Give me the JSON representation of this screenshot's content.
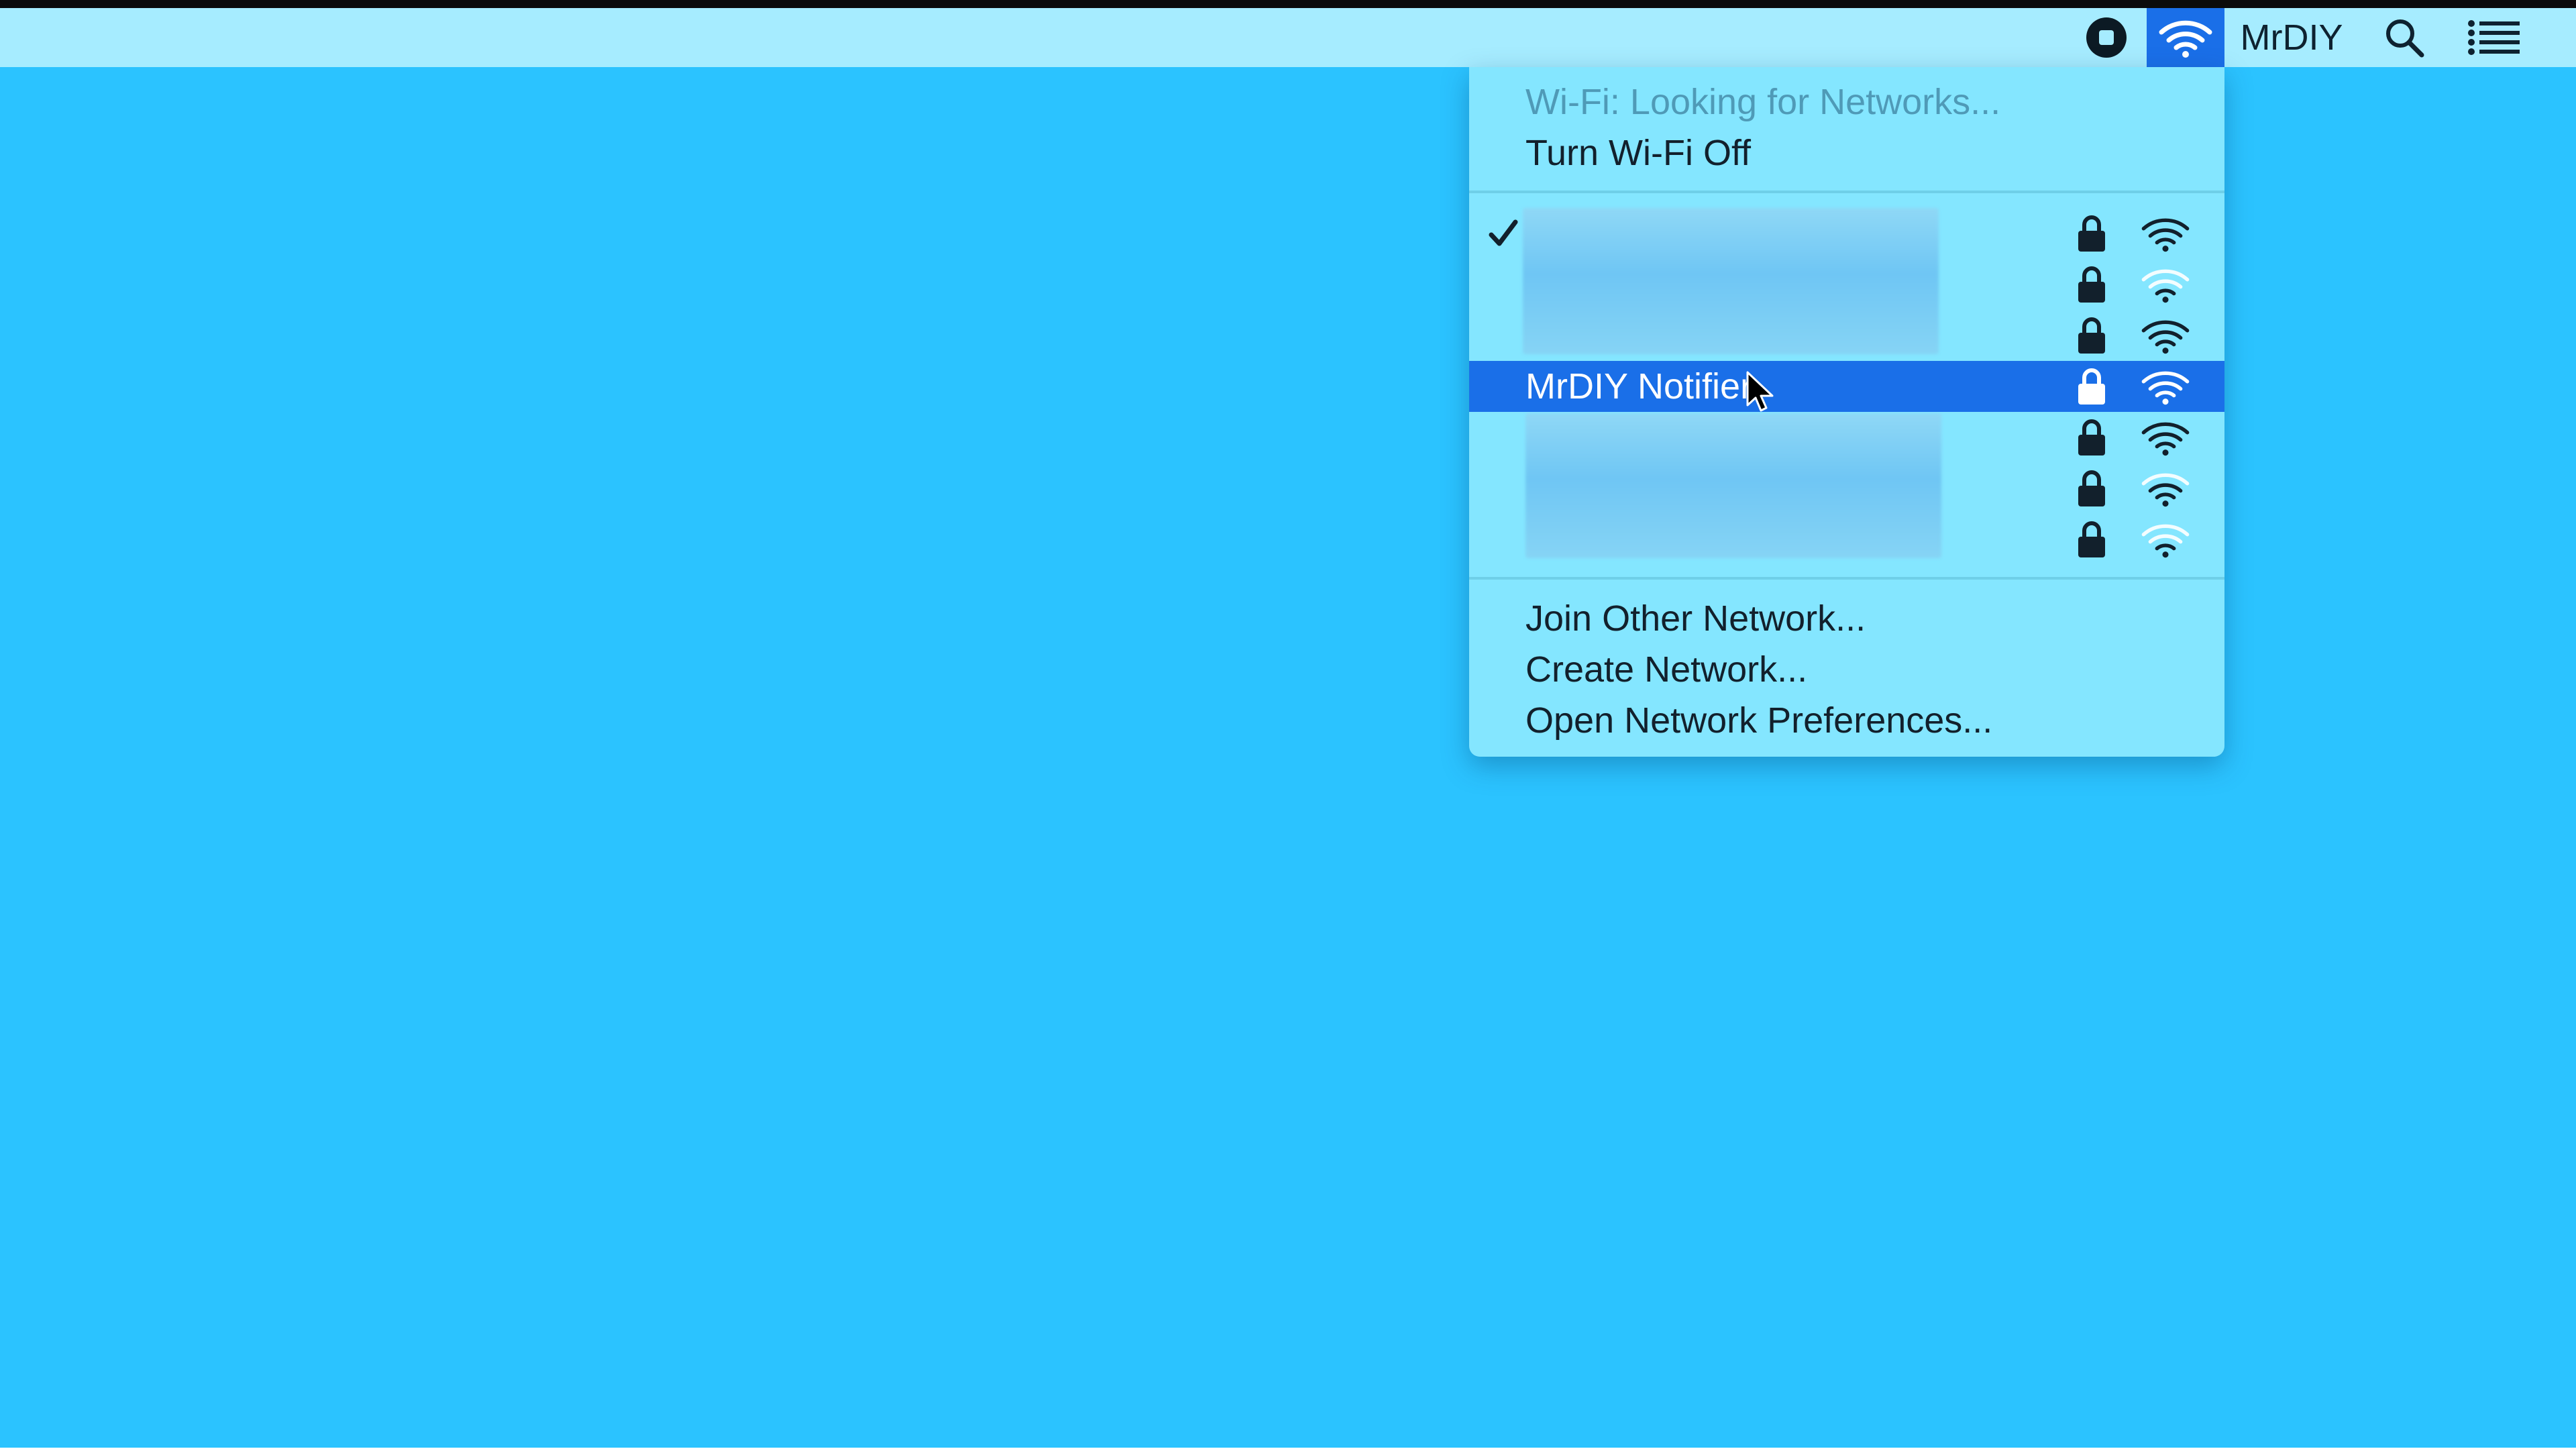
{
  "menubar": {
    "username": "MrDIY",
    "icons": [
      "stop-record-icon",
      "wifi-icon",
      "search-icon",
      "list-icon"
    ]
  },
  "wifi_menu": {
    "status": "Wi-Fi: Looking for Networks...",
    "toggle_label": "Turn Wi-Fi Off",
    "networks": [
      {
        "name": "",
        "connected": true,
        "locked": true,
        "signal": "full"
      },
      {
        "name": "",
        "connected": false,
        "locked": true,
        "signal": "weak"
      },
      {
        "name": "",
        "connected": false,
        "locked": true,
        "signal": "full"
      },
      {
        "name": "MrDIY Notifier",
        "connected": false,
        "locked": true,
        "signal": "full",
        "highlighted": true
      },
      {
        "name": "",
        "connected": false,
        "locked": true,
        "signal": "full"
      },
      {
        "name": "",
        "connected": false,
        "locked": true,
        "signal": "medium"
      },
      {
        "name": "",
        "connected": false,
        "locked": true,
        "signal": "weak"
      }
    ],
    "actions": {
      "join": "Join Other Network...",
      "create": "Create Network...",
      "preferences": "Open Network Preferences..."
    }
  },
  "colors": {
    "desktop": "#2bc3ff",
    "menubar": "#a6ecff",
    "menu": "#84e6ff",
    "highlight": "#1a6fe8"
  }
}
